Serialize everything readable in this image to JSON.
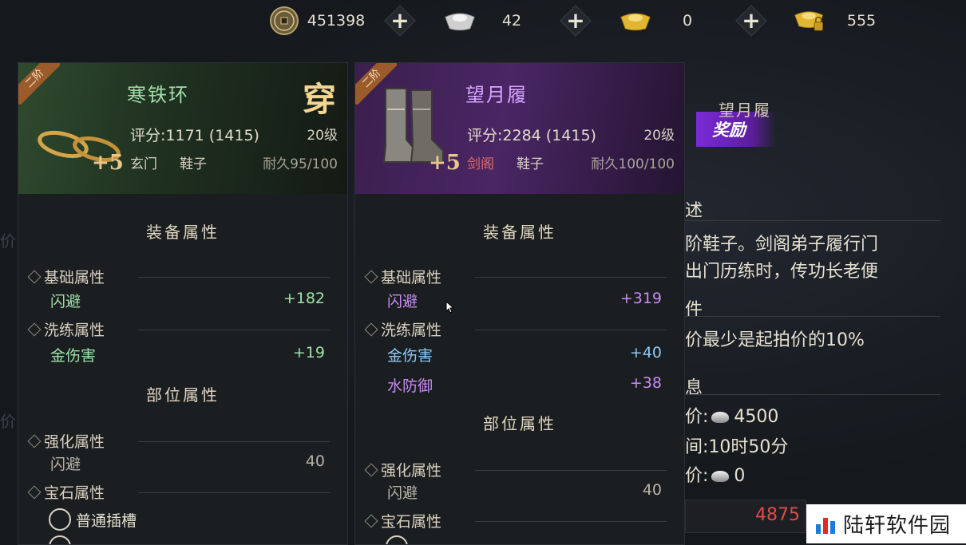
{
  "currency": {
    "copper": {
      "icon": "copper-coin-icon",
      "value": "451398"
    },
    "silver": {
      "icon": "silver-ingot-icon",
      "value": "42"
    },
    "gold": {
      "icon": "gold-ingot-icon",
      "value": "0"
    },
    "bound_gold": {
      "icon": "locked-gold-icon",
      "value": "555"
    },
    "plus": "+"
  },
  "left_item": {
    "tier": "二阶",
    "name": "寒铁环",
    "wear_tag": "穿",
    "enhance": "+5",
    "score": "评分:1171 (1415)",
    "level": "20级",
    "sect": "玄门",
    "slot": "鞋子",
    "durability": "耐久95/100",
    "sections": {
      "equip_attr": "装备属性",
      "part_attr": "部位属性"
    },
    "base_title": "基础属性",
    "base": [
      {
        "name": "闪避",
        "value": "+182"
      }
    ],
    "refine_title": "洗练属性",
    "refine": [
      {
        "name": "金伤害",
        "value": "+19"
      }
    ],
    "strengthen_title": "强化属性",
    "strengthen": [
      {
        "name": "闪避",
        "value": "40"
      }
    ],
    "gem_title": "宝石属性",
    "gem_slot": "普通插槽",
    "colors": {
      "name": "#9fe0a8",
      "sect": "#d8d2c4",
      "attr": "#9fe0a8"
    }
  },
  "right_item": {
    "tier": "二阶",
    "name": "望月履",
    "enhance": "+5",
    "score": "评分:2284 (1415)",
    "level": "20级",
    "sect": "剑阁",
    "slot": "鞋子",
    "durability": "耐久100/100",
    "sections": {
      "equip_attr": "装备属性",
      "part_attr": "部位属性"
    },
    "base_title": "基础属性",
    "base": [
      {
        "name": "闪避",
        "value": "+319"
      }
    ],
    "refine_title": "洗练属性",
    "refine": [
      {
        "name": "金伤害",
        "value": "+40"
      },
      {
        "name": "水防御",
        "value": "+38"
      }
    ],
    "strengthen_title": "强化属性",
    "strengthen": [
      {
        "name": "闪避",
        "value": "40"
      }
    ],
    "gem_title": "宝石属性",
    "colors": {
      "name": "#d6a4ff",
      "sect": "#e06a6a",
      "attr": "#c98af5"
    }
  },
  "info_panel": {
    "title": "望月履",
    "reward": "奖励",
    "desc_heading": "述",
    "desc_line1": "阶鞋子。剑阁弟子履行门",
    "desc_line2": "出门历练时，传功长老便",
    "cond_heading": "件",
    "cond_line": "价最少是起拍价的10%",
    "info_heading": "息",
    "price_line": "价:",
    "price_value": "4500",
    "time_line": "间:10时50分",
    "bid_line": "价:",
    "bid_value": "0",
    "input_value": "4875"
  },
  "watermark": "陆轩软件园"
}
